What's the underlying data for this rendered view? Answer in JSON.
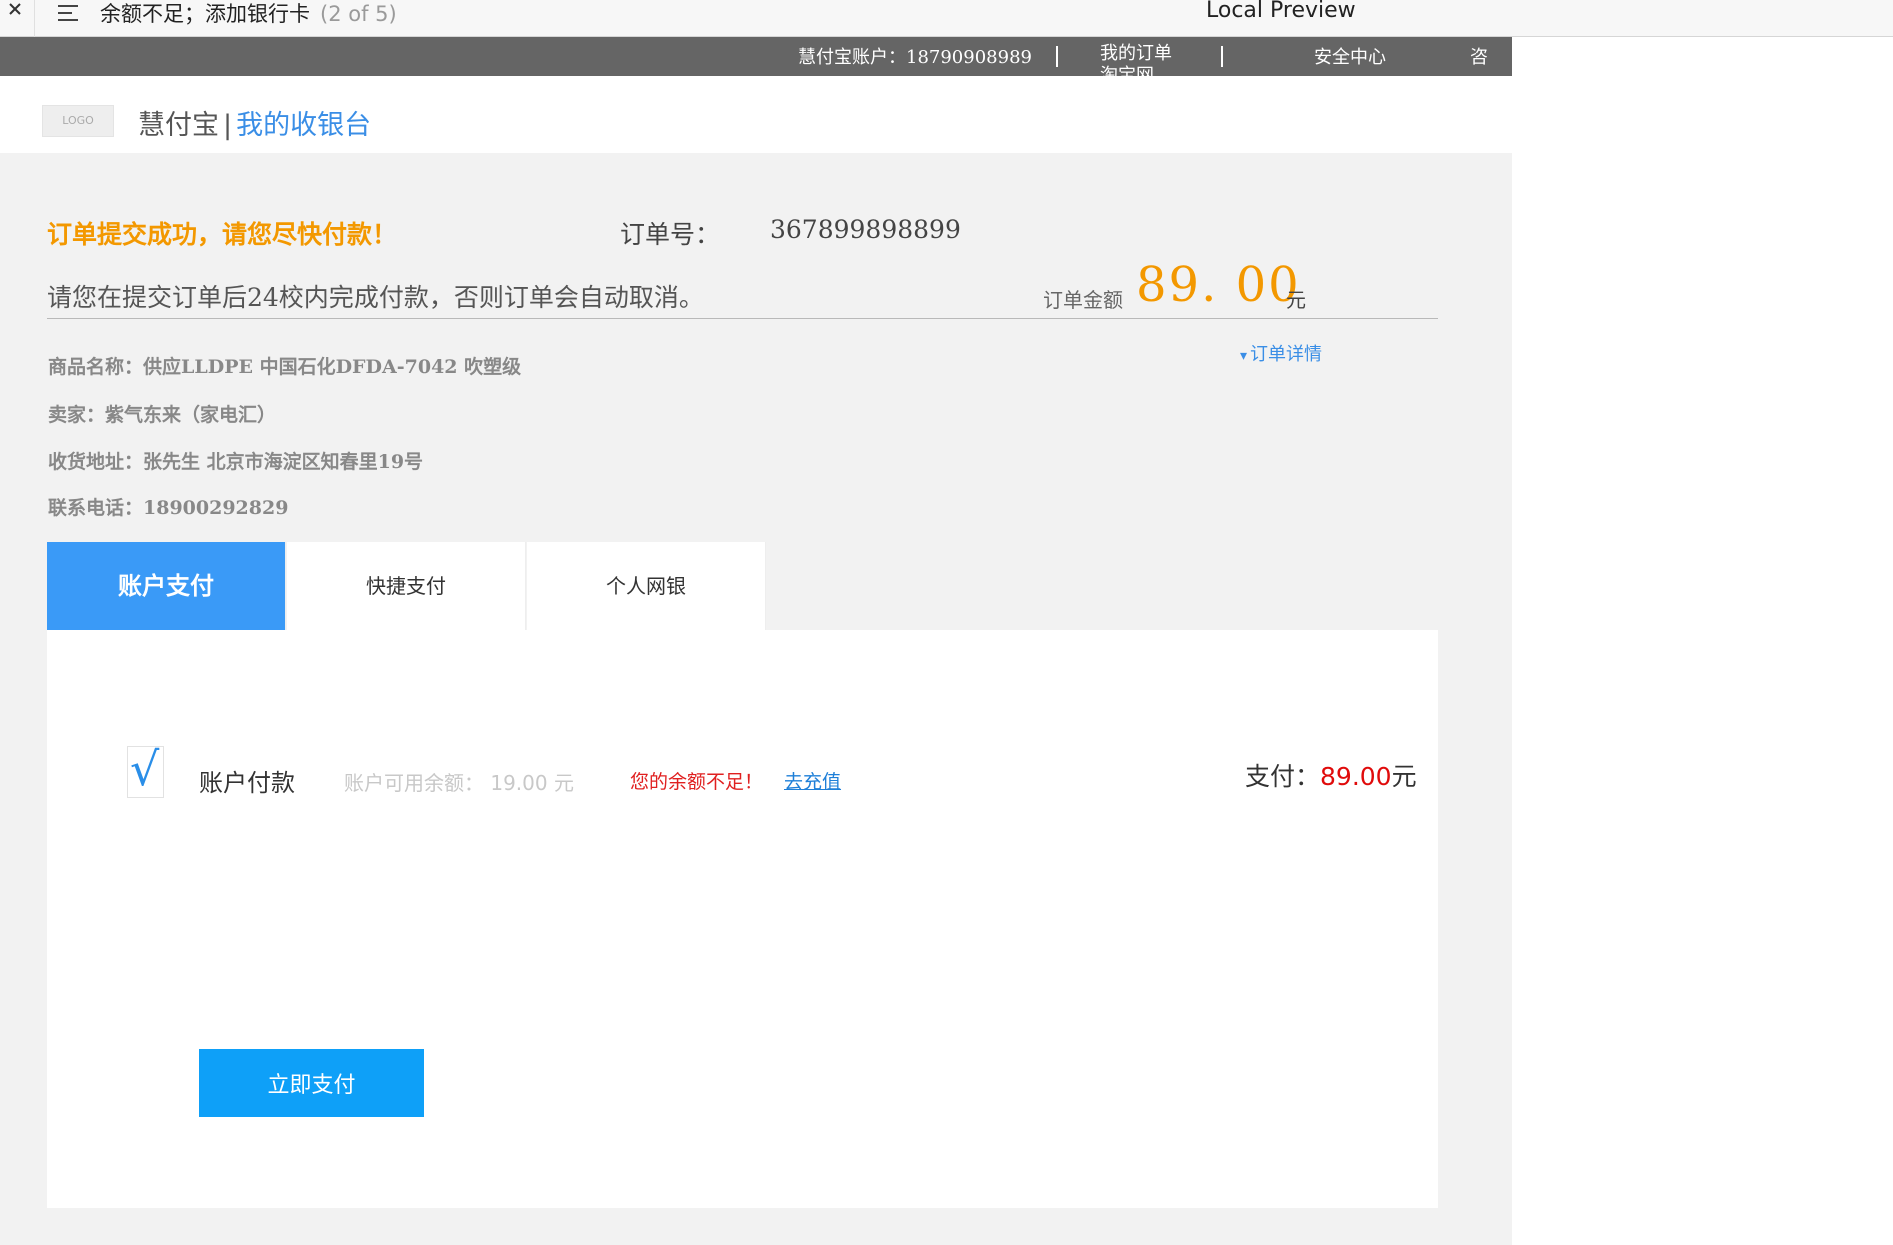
{
  "window": {
    "doc_title": "余额不足；添加银行卡",
    "doc_counter": "(2 of 5)",
    "app_title": "Local Preview"
  },
  "topbar": {
    "account": "慧付宝账户：18790908989",
    "my_orders": "我的订单",
    "my_orders_overflow": "淘宝网",
    "security_center": "安全中心",
    "consult": "咨"
  },
  "header": {
    "logo_text": "LOGO",
    "brand_name": "慧付宝",
    "brand_separator": "|",
    "brand_sub": "我的收银台"
  },
  "order": {
    "success_message": "订单提交成功，请您尽快付款！",
    "order_no_label": "订单号：",
    "order_no": "367899898899",
    "notice": "请您在提交订单后24校内完成付款，否则订单会自动取消。",
    "amount_label": "订单金额",
    "amount": "89. 00",
    "amount_unit": "元",
    "detail_link": "订单详情",
    "product_name": "商品名称：供应LLDPE 中国石化DFDA-7042 吹塑级",
    "seller": "卖家：紫气东来（家电汇）",
    "address": "收货地址：张先生 北京市海淀区知春里19号",
    "phone": "联系电话：18900292829"
  },
  "tabs": [
    {
      "label": "账户支付",
      "active": true
    },
    {
      "label": "快捷支付",
      "active": false
    },
    {
      "label": "个人网银",
      "active": false
    }
  ],
  "panel": {
    "check_mark": "√",
    "method_label": "账户付款",
    "balance_text": "账户可用余额： 19.00 元",
    "insufficient_text": "您的余额不足！",
    "recharge_link": "去充值",
    "pay_label": "支付：",
    "pay_amount": "89.00",
    "pay_unit": "元",
    "pay_now_button": "立即支付"
  },
  "colors": {
    "accent_orange": "#f39800",
    "tab_active_blue": "#3a9af7",
    "pay_button_blue": "#0ea0f8",
    "warning_red": "#e02020",
    "topbar_gray": "#656565"
  }
}
